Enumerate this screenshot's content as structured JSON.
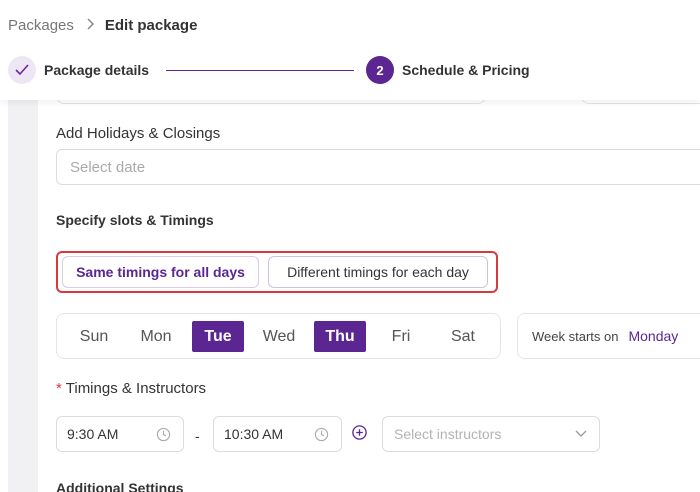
{
  "breadcrumb": {
    "parent": "Packages",
    "separator": ">",
    "current": "Edit package"
  },
  "stepper": {
    "steps": [
      {
        "label": "Package details",
        "state": "completed",
        "marker": "✓"
      },
      {
        "label": "Schedule & Pricing",
        "state": "active",
        "marker": "2"
      }
    ]
  },
  "holidays": {
    "label": "Add Holidays & Closings",
    "placeholder": "Select date"
  },
  "slots": {
    "heading": "Specify slots & Timings",
    "options": [
      {
        "label": "Same timings for all days",
        "selected": true
      },
      {
        "label": "Different timings for each day",
        "selected": false
      }
    ]
  },
  "days": [
    {
      "label": "Sun",
      "active": false
    },
    {
      "label": "Mon",
      "active": false
    },
    {
      "label": "Tue",
      "active": true
    },
    {
      "label": "Wed",
      "active": false
    },
    {
      "label": "Thu",
      "active": true
    },
    {
      "label": "Fri",
      "active": false
    },
    {
      "label": "Sat",
      "active": false
    }
  ],
  "week_start": {
    "label": "Week starts on",
    "value": "Monday"
  },
  "timings": {
    "required_mark": "*",
    "label": "Timings & Instructors",
    "start_time": "9:30 AM",
    "separator": "-",
    "end_time": "10:30 AM",
    "instructor_placeholder": "Select instructors"
  },
  "additional": {
    "heading": "Additional Settings"
  },
  "colors": {
    "primary": "#5b2691",
    "highlight_border": "#d8393f",
    "step_done_bg": "#ede6f5"
  }
}
